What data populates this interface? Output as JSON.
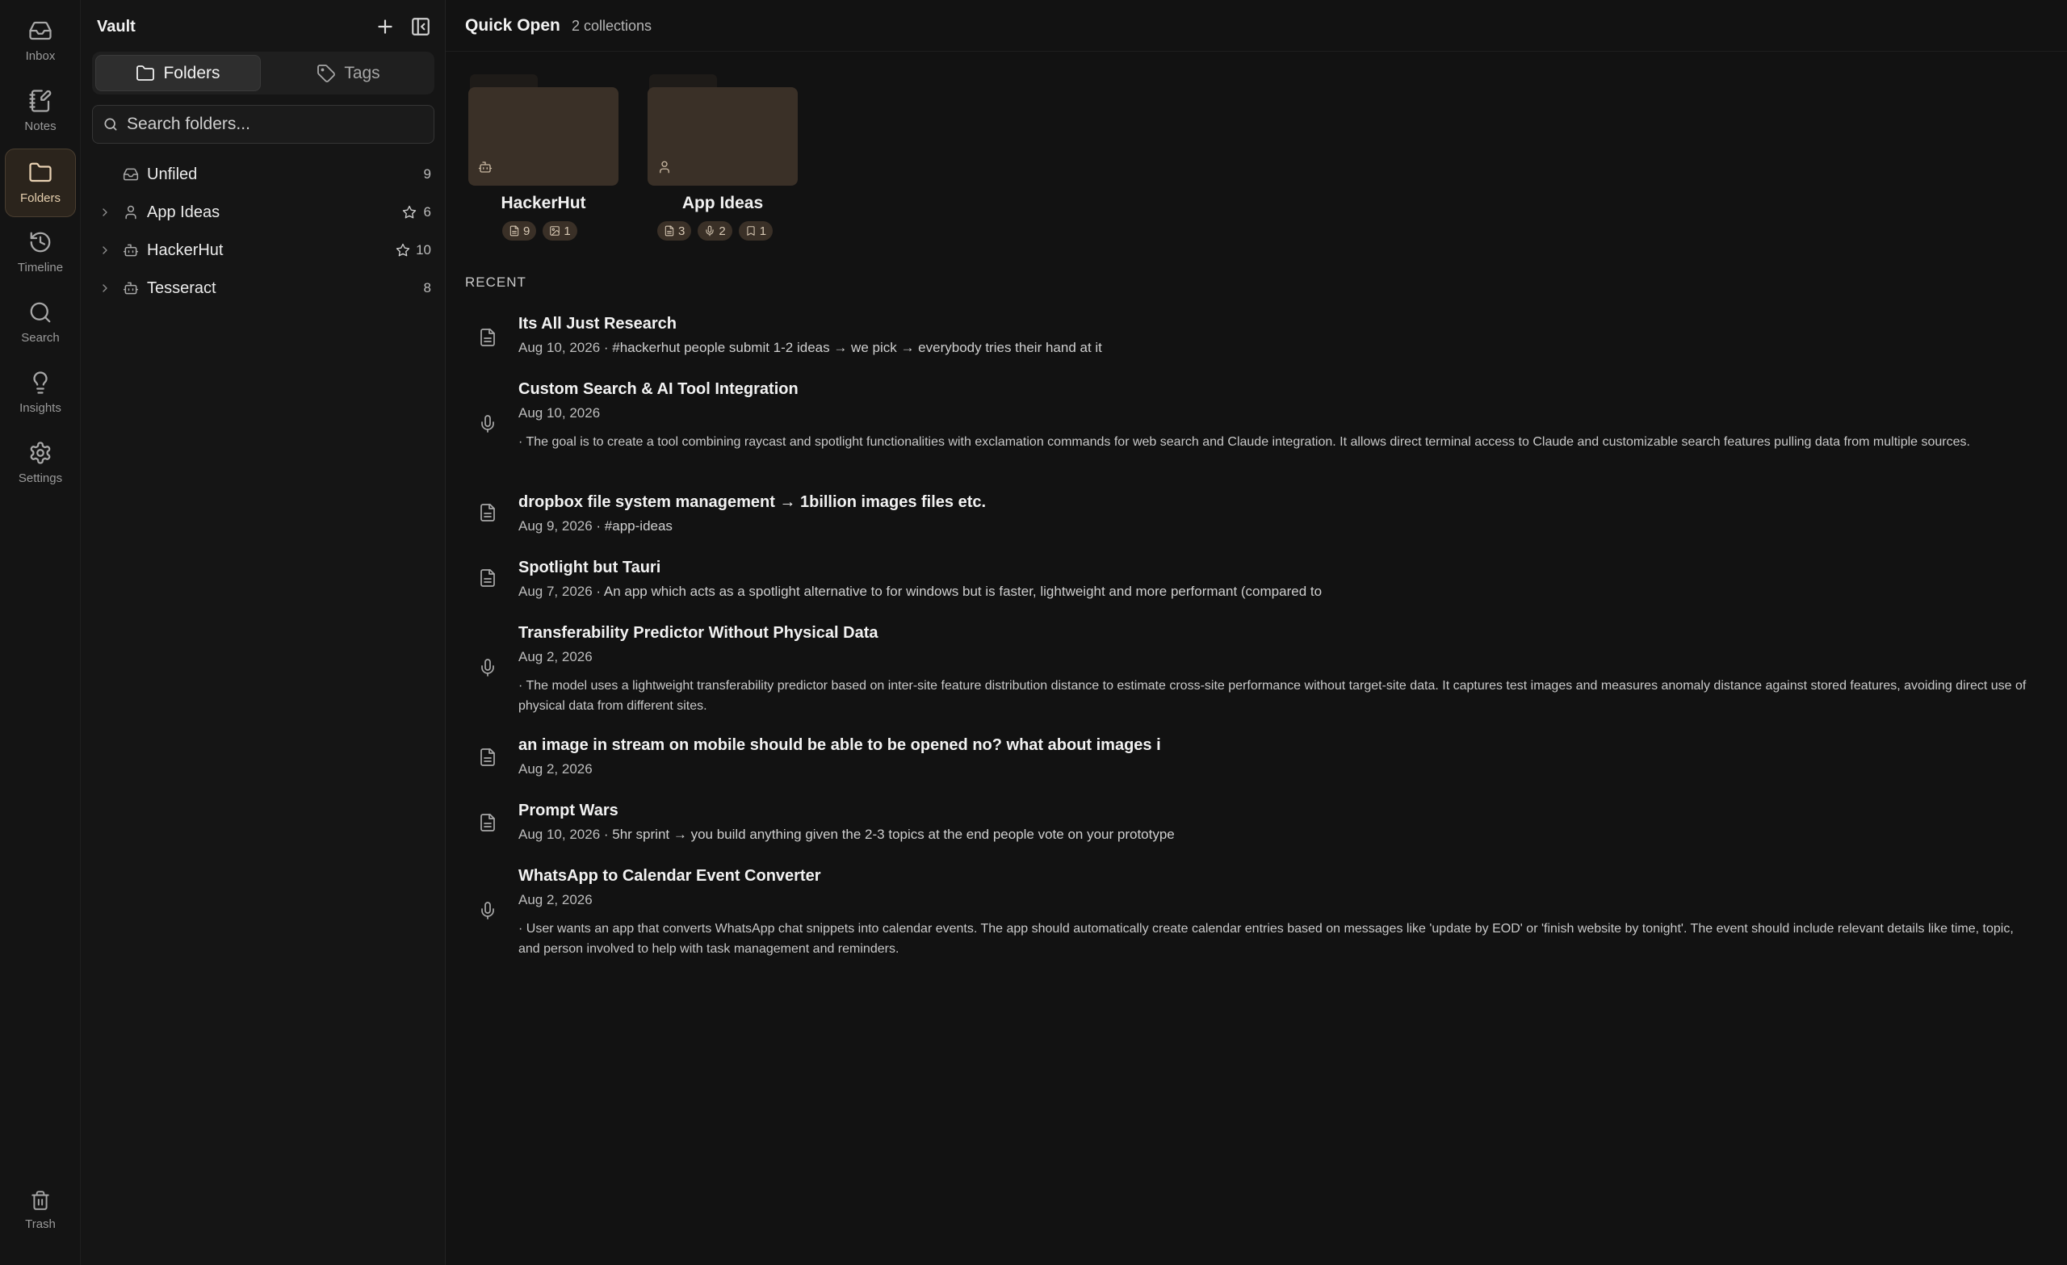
{
  "rail": {
    "items": [
      {
        "label": "Inbox",
        "icon": "inbox-icon"
      },
      {
        "label": "Notes",
        "icon": "notes-icon"
      },
      {
        "label": "Folders",
        "icon": "folder-icon",
        "active": true
      },
      {
        "label": "Timeline",
        "icon": "history-icon"
      },
      {
        "label": "Search",
        "icon": "search-icon"
      },
      {
        "label": "Insights",
        "icon": "lightbulb-icon"
      },
      {
        "label": "Settings",
        "icon": "gear-icon"
      }
    ],
    "trash_label": "Trash"
  },
  "sidebar": {
    "title": "Vault",
    "tabs": {
      "folders": "Folders",
      "tags": "Tags"
    },
    "search_placeholder": "Search folders...",
    "tree": [
      {
        "label": "Unfiled",
        "count": "9",
        "icon": "inbox-icon",
        "expandable": false,
        "starred": false
      },
      {
        "label": "App Ideas",
        "count": "6",
        "icon": "user-icon",
        "expandable": true,
        "starred": true
      },
      {
        "label": "HackerHut",
        "count": "10",
        "icon": "bot-icon",
        "expandable": true,
        "starred": true
      },
      {
        "label": "Tesseract",
        "count": "8",
        "icon": "bot-icon",
        "expandable": true,
        "starred": false
      }
    ]
  },
  "main": {
    "title": "Quick Open",
    "subtitle": "2 collections",
    "collections": [
      {
        "name": "HackerHut",
        "icon": "bot-icon",
        "badges": [
          {
            "icon": "document-icon",
            "count": "9"
          },
          {
            "icon": "image-icon",
            "count": "1"
          }
        ]
      },
      {
        "name": "App Ideas",
        "icon": "user-icon",
        "badges": [
          {
            "icon": "document-icon",
            "count": "3"
          },
          {
            "icon": "microphone-icon",
            "count": "2"
          },
          {
            "icon": "bookmark-icon",
            "count": "1"
          }
        ]
      }
    ],
    "recent_label": "RECENT",
    "recent": [
      {
        "kind": "document-icon",
        "title": "Its All Just Research",
        "date": "Aug 10, 2026",
        "snippet": " · #hackerhut people submit 1-2 ideas → we pick → everybody tries their hand at it",
        "desc": ""
      },
      {
        "kind": "microphone-icon",
        "title": "Custom Search & AI Tool Integration",
        "date": "Aug 10, 2026",
        "snippet": "",
        "desc": "· The goal is to create a tool combining raycast and spotlight functionalities with exclamation commands for web search and Claude integration. It allows direct terminal access to Claude and customizable search features pulling data from multiple sources."
      },
      {
        "kind": "document-icon",
        "title": "dropbox file system management → 1billion images files etc.",
        "date": "Aug 9, 2026",
        "snippet": " · #app-ideas",
        "desc": ""
      },
      {
        "kind": "document-icon",
        "title": "Spotlight but Tauri",
        "date": "Aug 7, 2026",
        "snippet": " · An app which acts as a spotlight alternative to for windows but is faster, lightweight and more performant (compared to",
        "desc": ""
      },
      {
        "kind": "microphone-icon",
        "title": "Transferability Predictor Without Physical Data",
        "date": "Aug 2, 2026",
        "snippet": "",
        "desc": "· The model uses a lightweight transferability predictor based on inter-site feature distribution distance to estimate cross-site performance without target-site data. It captures test images and measures anomaly distance against stored features, avoiding direct use of physical data from different sites."
      },
      {
        "kind": "document-icon",
        "title": "an image in stream on mobile should be able to be opened no? what about images i",
        "date": "Aug 2, 2026",
        "snippet": "",
        "desc": ""
      },
      {
        "kind": "document-icon",
        "title": "Prompt Wars",
        "date": "Aug 10, 2026",
        "snippet": " · 5hr sprint → you build anything given the 2-3 topics at the end people vote on your prototype",
        "desc": ""
      },
      {
        "kind": "microphone-icon",
        "title": "WhatsApp to Calendar Event Converter",
        "date": "Aug 2, 2026",
        "snippet": "",
        "desc": "· User wants an app that converts WhatsApp chat snippets into calendar events. The app should automatically create calendar entries based on messages like 'update by EOD' or 'finish website by tonight'. The event should include relevant details like time, topic, and person involved to help with task management and reminders."
      }
    ]
  },
  "colors": {
    "background": "#121212",
    "accent": "#e6cfae",
    "folder_card": "#3a3027"
  }
}
